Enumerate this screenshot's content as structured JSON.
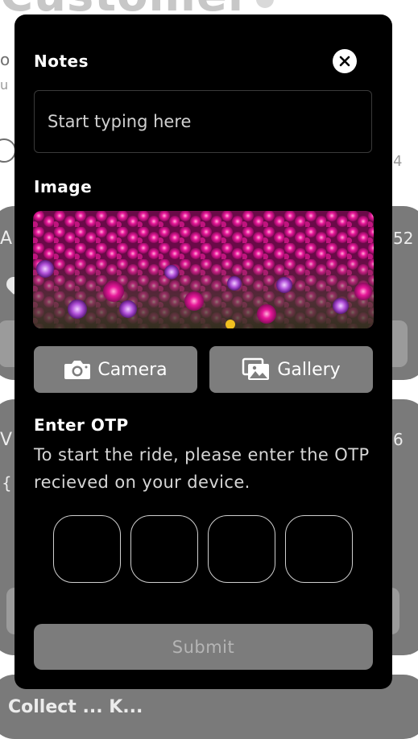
{
  "background": {
    "title": "Customer",
    "card_b_title": "Collect ... K..."
  },
  "modal": {
    "notes": {
      "title": "Notes",
      "placeholder": "Start typing here"
    },
    "image": {
      "title": "Image",
      "camera_label": "Camera",
      "gallery_label": "Gallery"
    },
    "otp": {
      "title": "Enter OTP",
      "description": "To start the ride, please enter the OTP recieved on your device.",
      "digit_count": 4
    },
    "submit_label": "Submit"
  },
  "colors": {
    "modal_bg": "#000000",
    "button_bg": "#7d7d7d",
    "submit_text": "#b5b5b5",
    "otp_border": "#cfcfcf"
  },
  "icons": {
    "close": "close-icon",
    "camera": "camera-icon",
    "gallery": "gallery-icon"
  }
}
